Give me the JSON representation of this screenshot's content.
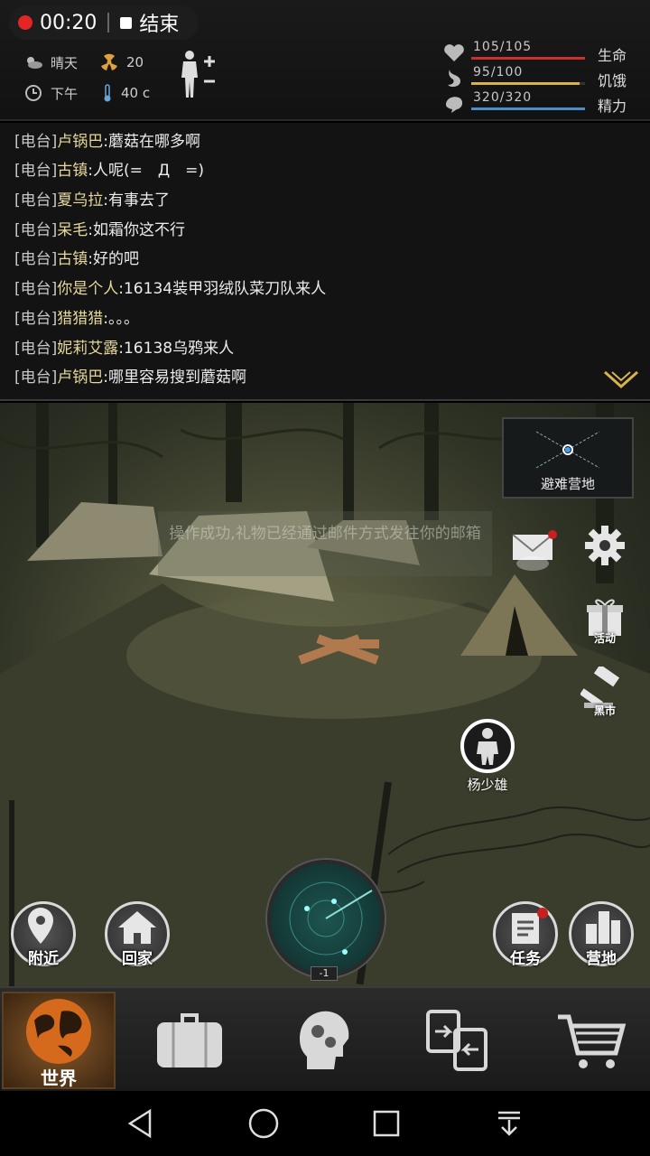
{
  "recorder": {
    "time": "00:20",
    "end_label": "结束"
  },
  "hud": {
    "weather": "晴天",
    "radiation": "20",
    "time_of_day": "下午",
    "temperature": "40 c",
    "stats": {
      "hp": {
        "value": "105/105",
        "label": "生命",
        "ratio": 1.0,
        "color": "#c8322c"
      },
      "hunger": {
        "value": "95/100",
        "label": "饥饿",
        "ratio": 0.95,
        "color": "#d8b24a"
      },
      "stamina": {
        "value": "320/320",
        "label": "精力",
        "ratio": 1.0,
        "color": "#4a8fc8"
      }
    }
  },
  "chat": {
    "lines": [
      {
        "channel": "[电台]",
        "name": "卢锅巴",
        "msg": ":蘑菇在哪多啊"
      },
      {
        "channel": "[电台]",
        "name": "古镇",
        "msg": ":人呢(=　Д　=)"
      },
      {
        "channel": "[电台]",
        "name": "夏乌拉",
        "msg": ":有事去了"
      },
      {
        "channel": "[电台]",
        "name": "呆毛",
        "msg": ":如霜你这不行"
      },
      {
        "channel": "[电台]",
        "name": "古镇",
        "msg": ":好的吧"
      },
      {
        "channel": "[电台]",
        "name": "你是个人",
        "msg": ":16134装甲羽绒队菜刀队来人"
      },
      {
        "channel": "[电台]",
        "name": "猎猎猎",
        "msg": ":。。。"
      },
      {
        "channel": "[电台]",
        "name": "妮莉艾露",
        "msg": ":16138乌鸦来人"
      },
      {
        "channel": "[电台]",
        "name": "卢锅巴",
        "msg": ":哪里容易搜到蘑菇啊"
      }
    ]
  },
  "scene": {
    "notice": "操作成功,礼物已经通过邮件方式发往你的邮箱",
    "minimap_label": "避难营地",
    "event_label": "活动",
    "market_label": "黑市",
    "player_name": "杨少雄",
    "nearby_label": "附近",
    "home_label": "回家",
    "task_label": "任务",
    "camp_label": "营地",
    "radar_count": "-1"
  },
  "nav": {
    "world_label": "世界"
  },
  "icons": [
    "weather-sun-cloud-icon",
    "radiation-icon",
    "clock-icon",
    "thermometer-icon",
    "heart-icon",
    "stomach-icon",
    "stamina-icon",
    "mail-icon",
    "gear-icon",
    "gift-icon",
    "gavel-icon",
    "location-pin-icon",
    "house-icon",
    "task-scroll-icon",
    "buildings-icon",
    "briefcase-icon",
    "head-gears-icon",
    "trade-icon",
    "cart-icon"
  ]
}
